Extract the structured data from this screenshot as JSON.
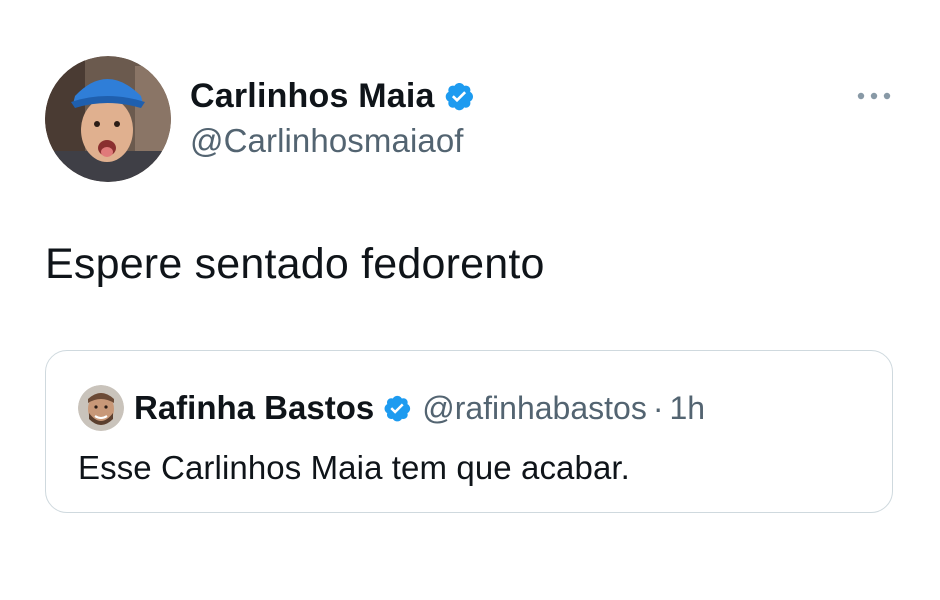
{
  "tweet": {
    "author": {
      "name": "Carlinhos Maia",
      "handle": "@Carlinhosmaiaof",
      "verified": true
    },
    "text": "Espere sentado fedorento",
    "more_icon": "more-horizontal-icon",
    "quote": {
      "author": {
        "name": "Rafinha Bastos",
        "handle": "@rafinhabastos",
        "verified": true
      },
      "separator": "·",
      "time": "1h",
      "text": "Esse Carlinhos Maia tem que acabar."
    }
  },
  "colors": {
    "verified_blue": "#1d9bf0",
    "text_primary": "#0f1419",
    "text_secondary": "#536471",
    "border": "#cfd9de"
  }
}
